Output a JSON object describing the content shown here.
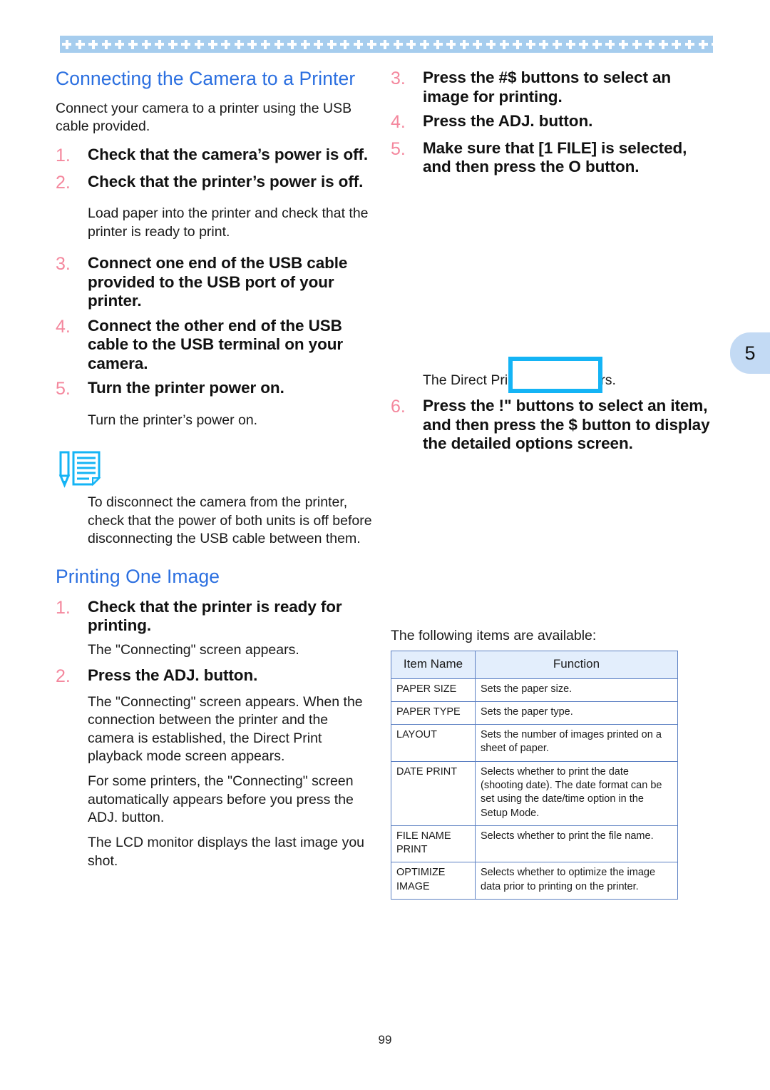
{
  "page": {
    "folio": "99",
    "chapter_tab": "5"
  },
  "left_column": {
    "heading": "Connecting the Camera to a Printer",
    "intro": "Connect your camera to a printer using the USB cable provided.",
    "steps": [
      {
        "num": "1.",
        "text": "Check that the camera’s power is off."
      },
      {
        "num": "2.",
        "text": "Check that the printer’s power is off."
      }
    ],
    "after_step2_note": "Load paper into the printer and check that the printer is ready to print.",
    "steps_cont": [
      {
        "num": "3.",
        "text": "Connect one end of the USB cable provided to the USB port of your printer."
      },
      {
        "num": "4.",
        "text": "Connect the other end of the USB cable to the USB terminal on your camera."
      },
      {
        "num": "5.",
        "text": "Turn the printer power on."
      }
    ],
    "after_step5_note": "Turn the printer’s power on.",
    "note": {
      "icon": "note-memo-icon",
      "text": "To disconnect the camera from the printer, check that the power of both units is off before disconnecting the USB cable between them."
    },
    "heading2": "Printing One Image",
    "steps2": [
      {
        "num": "1.",
        "text": "Check that the printer is ready for printing."
      }
    ],
    "after_p1_note": "The \"Connecting\" screen appears.",
    "steps2_cont": [
      {
        "num": "2.",
        "text": "Press the ADJ. button."
      }
    ],
    "after_p2_notes": [
      "The \"Connecting\" screen appears. When the connection between the printer and the camera is established, the Direct Print playback mode screen appears.",
      "For some printers, the \"Connecting\" screen automatically appears before you press the ADJ. button.",
      "The LCD monitor displays the last image you shot."
    ]
  },
  "right_column": {
    "steps": [
      {
        "num": "3.",
        "text": "Press the #$   buttons to select an image for printing."
      },
      {
        "num": "4.",
        "text": "Press the ADJ. button."
      },
      {
        "num": "5.",
        "text": "Make sure that [1 FILE] is selected, and then press the O button."
      }
    ],
    "figure_caption": "The Direct Print menu appears.",
    "steps_cont": [
      {
        "num": "6.",
        "text": "Press the !\"   buttons to select an item, and then press the  $ button to display the detailed options screen."
      }
    ],
    "table_intro": "The following items are available:",
    "table": {
      "headers": [
        "Item Name",
        "Function"
      ],
      "rows": [
        {
          "item": "PAPER SIZE",
          "function": "Sets the paper size."
        },
        {
          "item": "PAPER TYPE",
          "function": "Sets the paper type."
        },
        {
          "item": "LAYOUT",
          "function": "Sets the number of images printed on a sheet of paper."
        },
        {
          "item": "DATE PRINT",
          "function": "Selects whether to print the date (shooting date). The date format can be set using the date/time option in the Setup Mode."
        },
        {
          "item": "FILE NAME PRINT",
          "function": "Selects whether to print the file name."
        },
        {
          "item": "OPTIMIZE IMAGE",
          "function": "Selects whether to optimize the image data prior to printing on the printer."
        }
      ]
    }
  },
  "colors": {
    "heading_blue": "#2b6fe0",
    "step_number_pink": "#f4879d",
    "band_blue": "#a6cdee",
    "tab_blue": "#c3daf4",
    "rule_blue": "#5b7fc2",
    "figure_border_cyan": "#14b4f5"
  }
}
